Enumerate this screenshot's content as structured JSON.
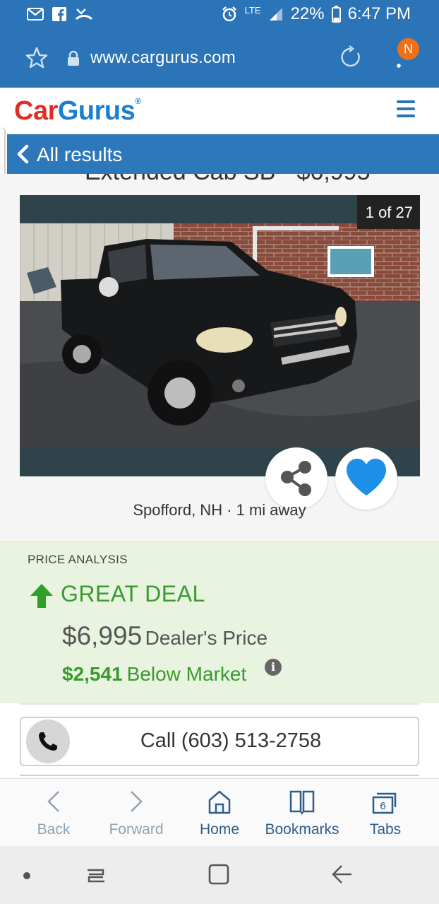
{
  "status_bar": {
    "battery": "22%",
    "time": "6:47 PM",
    "network": "LTE"
  },
  "browser": {
    "url": "www.cargurus.com",
    "notification_badge": "N"
  },
  "site": {
    "logo_car": "Car",
    "logo_gurus": "Gurus",
    "logo_mark": "®"
  },
  "nav": {
    "back_label": "All results"
  },
  "listing": {
    "title_partial": "Extended Cab SB - $6,995",
    "photo_counter": "1 of 27",
    "location": "Spofford, NH · 1 mi away"
  },
  "price_analysis": {
    "section_label": "PRICE ANALYSIS",
    "deal_rating": "GREAT DEAL",
    "price": "$6,995",
    "price_label": "Dealer's Price",
    "below_amount": "$2,541",
    "below_label": "Below Market",
    "info_glyph": "i"
  },
  "call": {
    "label": "Call (603) 513-2758"
  },
  "toolbar": {
    "back": "Back",
    "forward": "Forward",
    "home": "Home",
    "bookmarks": "Bookmarks",
    "tabs": "Tabs",
    "tab_count": "6"
  },
  "colors": {
    "brand_blue": "#2b74b8",
    "deal_green": "#3a9a30",
    "logo_red": "#e22d26",
    "favorite_blue": "#1e8fe6",
    "badge_orange": "#f0701a"
  }
}
